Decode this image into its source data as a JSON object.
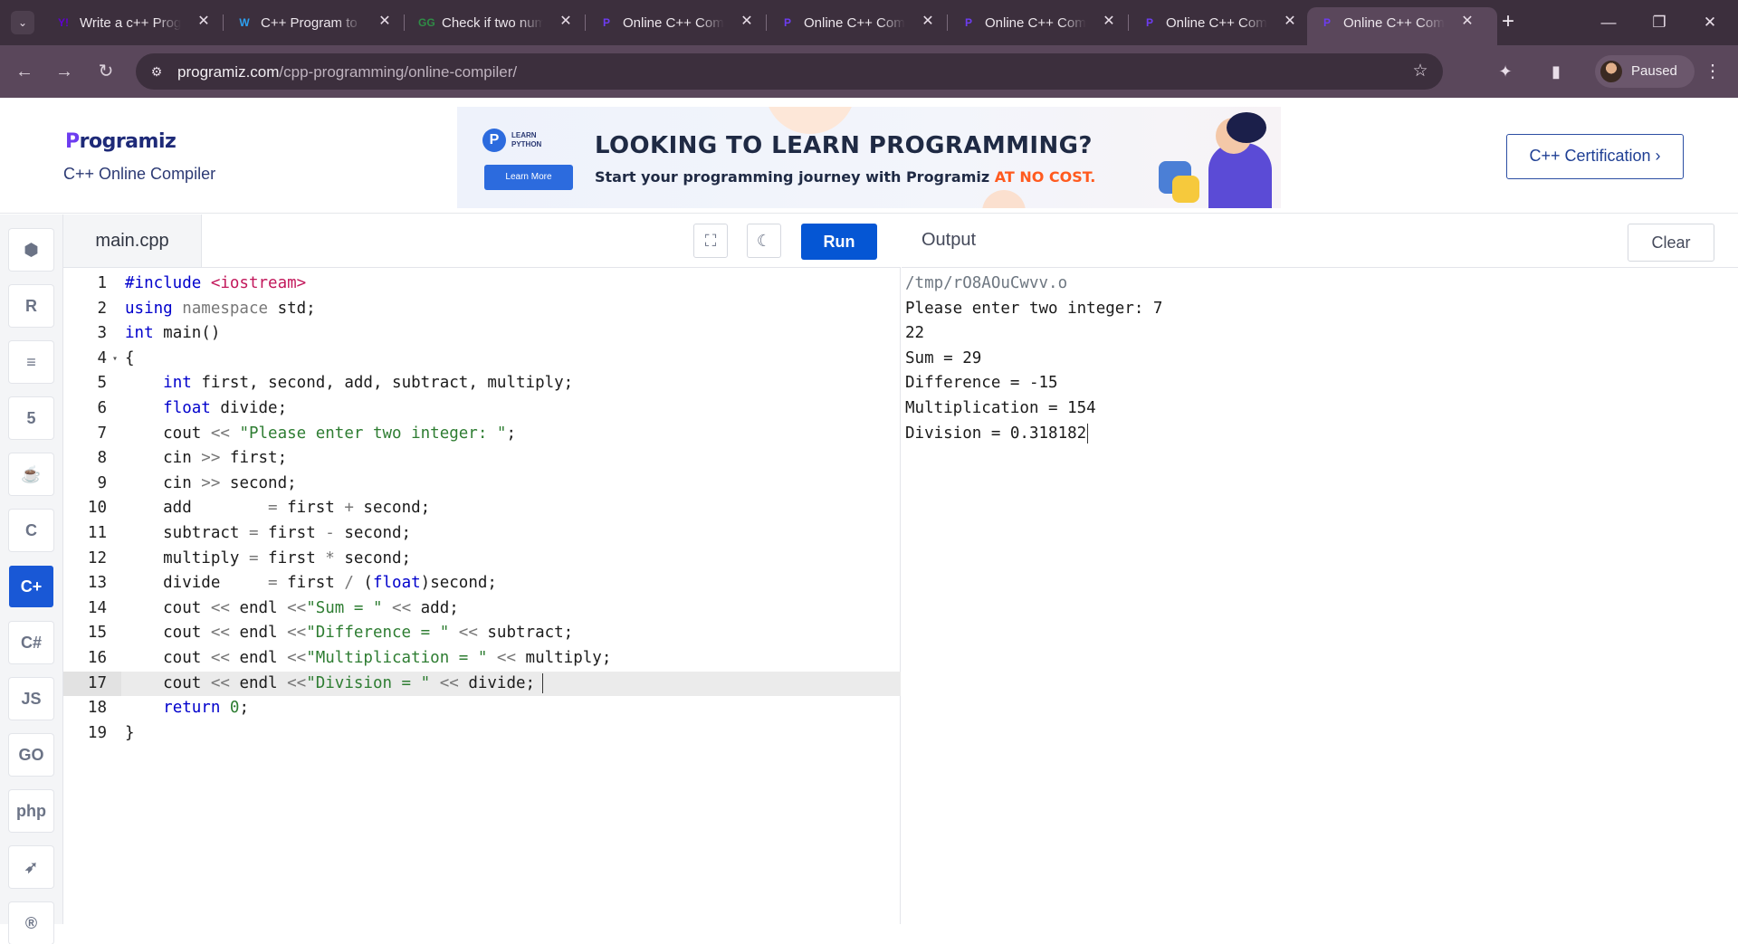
{
  "browser": {
    "tabs": [
      {
        "title": "Write a c++ Prog",
        "favicon": "Y!",
        "favicon_color": "#6001d2"
      },
      {
        "title": "C++ Program to",
        "favicon": "W",
        "favicon_color": "#2da0f0"
      },
      {
        "title": "Check if two num",
        "favicon": "GG",
        "favicon_color": "#2f8d46"
      },
      {
        "title": "Online C++ Com",
        "favicon": "P",
        "favicon_color": "#6d3cf0"
      },
      {
        "title": "Online C++ Com",
        "favicon": "P",
        "favicon_color": "#6d3cf0"
      },
      {
        "title": "Online C++ Com",
        "favicon": "P",
        "favicon_color": "#6d3cf0"
      },
      {
        "title": "Online C++ Com",
        "favicon": "P",
        "favicon_color": "#6d3cf0"
      },
      {
        "title": "Online C++ Com",
        "favicon": "P",
        "favicon_color": "#6d3cf0",
        "active": true
      }
    ],
    "url_domain": "programiz.com",
    "url_path": "/cpp-programming/online-compiler/",
    "profile_label": "Paused"
  },
  "header": {
    "logo_first": "P",
    "logo_rest": "rogramiz",
    "subtitle": "C++ Online Compiler",
    "certification_button": "C++ Certification ›"
  },
  "ad": {
    "badge_text": "LEARN PYTHON",
    "button": "Learn More",
    "headline": "LOOKING TO LEARN PROGRAMMING?",
    "subline": "Start your programming journey with Programiz ",
    "highlight": "AT NO COST."
  },
  "rail": [
    {
      "name": "python-icon",
      "glyph": "⬢"
    },
    {
      "name": "r-icon",
      "glyph": "R"
    },
    {
      "name": "sql-icon",
      "glyph": "≡"
    },
    {
      "name": "html-icon",
      "glyph": "5"
    },
    {
      "name": "java-icon",
      "glyph": "☕"
    },
    {
      "name": "c-icon",
      "glyph": "C"
    },
    {
      "name": "cpp-icon",
      "glyph": "C+",
      "active": true
    },
    {
      "name": "csharp-icon",
      "glyph": "C#"
    },
    {
      "name": "js-icon",
      "glyph": "JS"
    },
    {
      "name": "go-icon",
      "glyph": "GO"
    },
    {
      "name": "php-icon",
      "glyph": "php"
    },
    {
      "name": "swift-icon",
      "glyph": "➶"
    },
    {
      "name": "rust-icon",
      "glyph": "®"
    }
  ],
  "editor": {
    "file_name": "main.cpp",
    "run_label": "Run",
    "current_line": 17,
    "lines": [
      [
        [
          "#include ",
          "#0000cc"
        ],
        [
          "<iostream>",
          "#c2185b"
        ]
      ],
      [
        [
          "using ",
          "#0000cc"
        ],
        [
          "namespace ",
          "#777777"
        ],
        [
          "std;",
          "#1b1b1b"
        ]
      ],
      [
        [
          "int ",
          "#0000cc"
        ],
        [
          "main()",
          "#1b1b1b"
        ]
      ],
      [
        [
          "{",
          "#1b1b1b"
        ]
      ],
      [
        [
          "    ",
          "#1b1b1b"
        ],
        [
          "int ",
          "#0000cc"
        ],
        [
          "first, second, add, subtract, multiply;",
          "#1b1b1b"
        ]
      ],
      [
        [
          "    ",
          "#1b1b1b"
        ],
        [
          "float ",
          "#0000cc"
        ],
        [
          "divide;",
          "#1b1b1b"
        ]
      ],
      [
        [
          "    cout ",
          "#1b1b1b"
        ],
        [
          "<< ",
          "#777777"
        ],
        [
          "\"Please enter two integer: \"",
          "#2e7d32"
        ],
        [
          ";",
          "#1b1b1b"
        ]
      ],
      [
        [
          "    cin ",
          "#1b1b1b"
        ],
        [
          ">> ",
          "#777777"
        ],
        [
          "first;",
          "#1b1b1b"
        ]
      ],
      [
        [
          "    cin ",
          "#1b1b1b"
        ],
        [
          ">> ",
          "#777777"
        ],
        [
          "second;",
          "#1b1b1b"
        ]
      ],
      [
        [
          "    add        ",
          "#1b1b1b"
        ],
        [
          "= ",
          "#777777"
        ],
        [
          "first ",
          "#1b1b1b"
        ],
        [
          "+ ",
          "#777777"
        ],
        [
          "second;",
          "#1b1b1b"
        ]
      ],
      [
        [
          "    subtract ",
          "#1b1b1b"
        ],
        [
          "= ",
          "#777777"
        ],
        [
          "first ",
          "#1b1b1b"
        ],
        [
          "- ",
          "#777777"
        ],
        [
          "second;",
          "#1b1b1b"
        ]
      ],
      [
        [
          "    multiply ",
          "#1b1b1b"
        ],
        [
          "= ",
          "#777777"
        ],
        [
          "first ",
          "#1b1b1b"
        ],
        [
          "* ",
          "#777777"
        ],
        [
          "second;",
          "#1b1b1b"
        ]
      ],
      [
        [
          "    divide     ",
          "#1b1b1b"
        ],
        [
          "= ",
          "#777777"
        ],
        [
          "first ",
          "#1b1b1b"
        ],
        [
          "/ ",
          "#777777"
        ],
        [
          "(",
          "#1b1b1b"
        ],
        [
          "float",
          "#0000cc"
        ],
        [
          ")second;",
          "#1b1b1b"
        ]
      ],
      [
        [
          "    cout ",
          "#1b1b1b"
        ],
        [
          "<< ",
          "#777777"
        ],
        [
          "endl ",
          "#1b1b1b"
        ],
        [
          "<<",
          "#777777"
        ],
        [
          "\"Sum = \" ",
          "#2e7d32"
        ],
        [
          "<< ",
          "#777777"
        ],
        [
          "add;",
          "#1b1b1b"
        ]
      ],
      [
        [
          "    cout ",
          "#1b1b1b"
        ],
        [
          "<< ",
          "#777777"
        ],
        [
          "endl ",
          "#1b1b1b"
        ],
        [
          "<<",
          "#777777"
        ],
        [
          "\"Difference = \" ",
          "#2e7d32"
        ],
        [
          "<< ",
          "#777777"
        ],
        [
          "subtract;",
          "#1b1b1b"
        ]
      ],
      [
        [
          "    cout ",
          "#1b1b1b"
        ],
        [
          "<< ",
          "#777777"
        ],
        [
          "endl ",
          "#1b1b1b"
        ],
        [
          "<<",
          "#777777"
        ],
        [
          "\"Multiplication = \" ",
          "#2e7d32"
        ],
        [
          "<< ",
          "#777777"
        ],
        [
          "multiply;",
          "#1b1b1b"
        ]
      ],
      [
        [
          "    cout ",
          "#1b1b1b"
        ],
        [
          "<< ",
          "#777777"
        ],
        [
          "endl ",
          "#1b1b1b"
        ],
        [
          "<<",
          "#777777"
        ],
        [
          "\"Division = \" ",
          "#2e7d32"
        ],
        [
          "<< ",
          "#777777"
        ],
        [
          "divide;",
          "#1b1b1b"
        ]
      ],
      [
        [
          "    ",
          "#1b1b1b"
        ],
        [
          "return ",
          "#0000cc"
        ],
        [
          "0",
          "#2e7d32"
        ],
        [
          ";",
          "#1b1b1b"
        ]
      ],
      [
        [
          "}",
          "#1b1b1b"
        ]
      ]
    ]
  },
  "output": {
    "title": "Output",
    "clear_label": "Clear",
    "lines": [
      "/tmp/rO8AOuCwvv.o",
      "Please enter two integer: 7",
      "22",
      "Sum = 29",
      "Difference = -15",
      "Multiplication = 154",
      "Division = 0.318182"
    ]
  },
  "colors": {
    "accent": "#0556d4",
    "chrome_dark": "#3c2f3d",
    "chrome_toolbar": "#5a475b"
  }
}
